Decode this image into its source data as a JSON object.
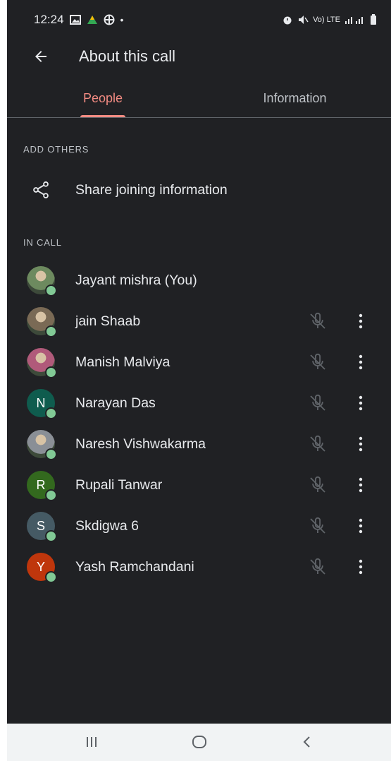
{
  "status_bar": {
    "time": "12:24",
    "right_text": "Vo) LTE"
  },
  "app_bar": {
    "title": "About this call"
  },
  "tabs": [
    {
      "label": "People"
    },
    {
      "label": "Information"
    }
  ],
  "sections": {
    "add_others": "ADD OTHERS",
    "in_call": "IN CALL"
  },
  "share": {
    "label": "Share joining information"
  },
  "participants": [
    {
      "name": "Jayant mishra (You)",
      "avatar_type": "photo",
      "avatar_color": "#6d8a5f",
      "muted_control": false
    },
    {
      "name": "jain Shaab",
      "avatar_type": "photo",
      "avatar_color": "#7a6a55",
      "muted_control": true
    },
    {
      "name": "Manish Malviya",
      "avatar_type": "photo",
      "avatar_color": "#b05a7a",
      "muted_control": true
    },
    {
      "name": "Narayan Das",
      "initial": "N",
      "avatar_type": "initial",
      "avatar_color": "#0f5c4e",
      "muted_control": true
    },
    {
      "name": "Naresh Vishwakarma",
      "avatar_type": "photo",
      "avatar_color": "#8a8f96",
      "muted_control": true
    },
    {
      "name": "Rupali Tanwar",
      "initial": "R",
      "avatar_type": "initial",
      "avatar_color": "#33691e",
      "muted_control": true
    },
    {
      "name": "Skdigwa 6",
      "initial": "S",
      "avatar_type": "initial",
      "avatar_color": "#455a64",
      "muted_control": true
    },
    {
      "name": "Yash Ramchandani",
      "initial": "Y",
      "avatar_type": "initial",
      "avatar_color": "#bf360c",
      "muted_control": true
    }
  ],
  "icons": {
    "back": "arrow-back-icon",
    "share": "share-icon",
    "mute": "mic-off-icon",
    "more": "more-vert-icon",
    "nav_recents": "recent-apps-icon",
    "nav_home": "home-icon",
    "nav_back": "nav-back-icon"
  },
  "colors": {
    "background": "#202124",
    "accent": "#f28b82",
    "presence": "#81c995",
    "nav_bar": "#f1f3f4"
  }
}
